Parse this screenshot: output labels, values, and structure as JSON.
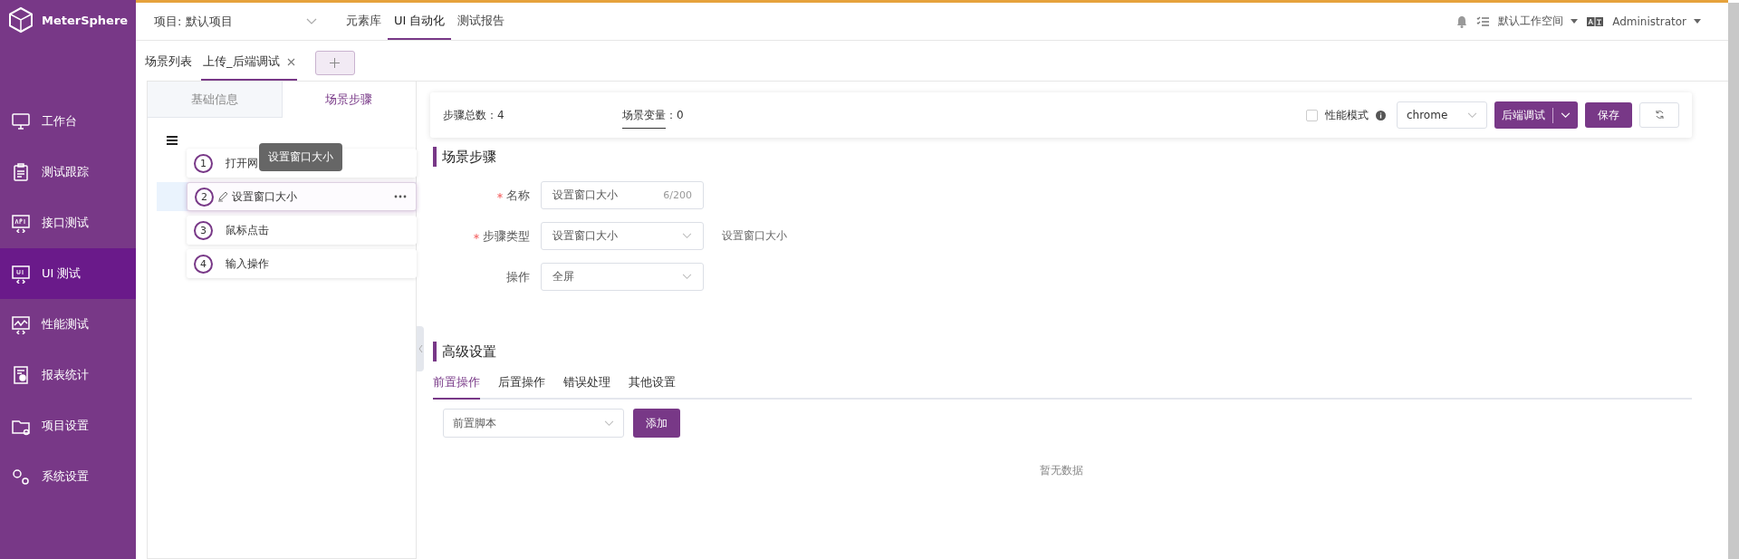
{
  "app": {
    "name": "MeterSphere"
  },
  "sidebar": {
    "items": [
      {
        "label": "工作台",
        "selected": false
      },
      {
        "label": "测试跟踪",
        "selected": false
      },
      {
        "label": "接口测试",
        "selected": false
      },
      {
        "label": "UI 测试",
        "selected": true
      },
      {
        "label": "性能测试",
        "selected": false
      },
      {
        "label": "报表统计",
        "selected": false
      },
      {
        "label": "项目设置",
        "selected": false
      },
      {
        "label": "系统设置",
        "selected": false
      }
    ]
  },
  "header": {
    "project": "项目: 默认项目",
    "nav": [
      {
        "label": "元素库",
        "selected": false
      },
      {
        "label": "UI 自动化",
        "selected": true
      },
      {
        "label": "测试报告",
        "selected": false
      }
    ],
    "workspace": "默认工作空间",
    "user": "Administrator"
  },
  "scenario_tabs": [
    {
      "label": "场景列表",
      "selected": false,
      "closable": false
    },
    {
      "label": "上传_后端调试",
      "selected": true,
      "closable": true
    }
  ],
  "left_panel": {
    "tabs": [
      {
        "label": "基础信息",
        "selected": false
      },
      {
        "label": "场景步骤",
        "selected": true
      }
    ],
    "steps": [
      {
        "number": "1",
        "label": "打开网",
        "selected": false
      },
      {
        "number": "2",
        "label": "设置窗口大小",
        "selected": true
      },
      {
        "number": "3",
        "label": "鼠标点击",
        "selected": false
      },
      {
        "number": "4",
        "label": "输入操作",
        "selected": false
      }
    ],
    "tooltip": "设置窗口大小"
  },
  "toolbar": {
    "step_count": "步骤总数：4",
    "variables_label": "场景变量",
    "variables_value": "：0",
    "performance_mode": {
      "label": "性能模式",
      "checked": false
    },
    "browser": "chrome",
    "run_button": "后端调试",
    "save_button": "保存"
  },
  "step_form": {
    "title": "场景步骤",
    "fields": [
      {
        "kind": "input",
        "label": "名称",
        "required": true,
        "value": "设置窗口大小",
        "counter": "6/200"
      },
      {
        "kind": "select",
        "label": "步骤类型",
        "required": true,
        "value": "设置窗口大小",
        "note": "设置窗口大小"
      },
      {
        "kind": "select",
        "label": "操作",
        "required": false,
        "value": "全屏"
      }
    ]
  },
  "advanced": {
    "title": "高级设置",
    "tabs": [
      {
        "label": "前置操作",
        "selected": true
      },
      {
        "label": "后置操作",
        "selected": false
      },
      {
        "label": "错误处理",
        "selected": false
      },
      {
        "label": "其他设置",
        "selected": false
      }
    ],
    "script_select": "前置脚本",
    "add_button": "添加",
    "empty_text": "暂无数据"
  }
}
